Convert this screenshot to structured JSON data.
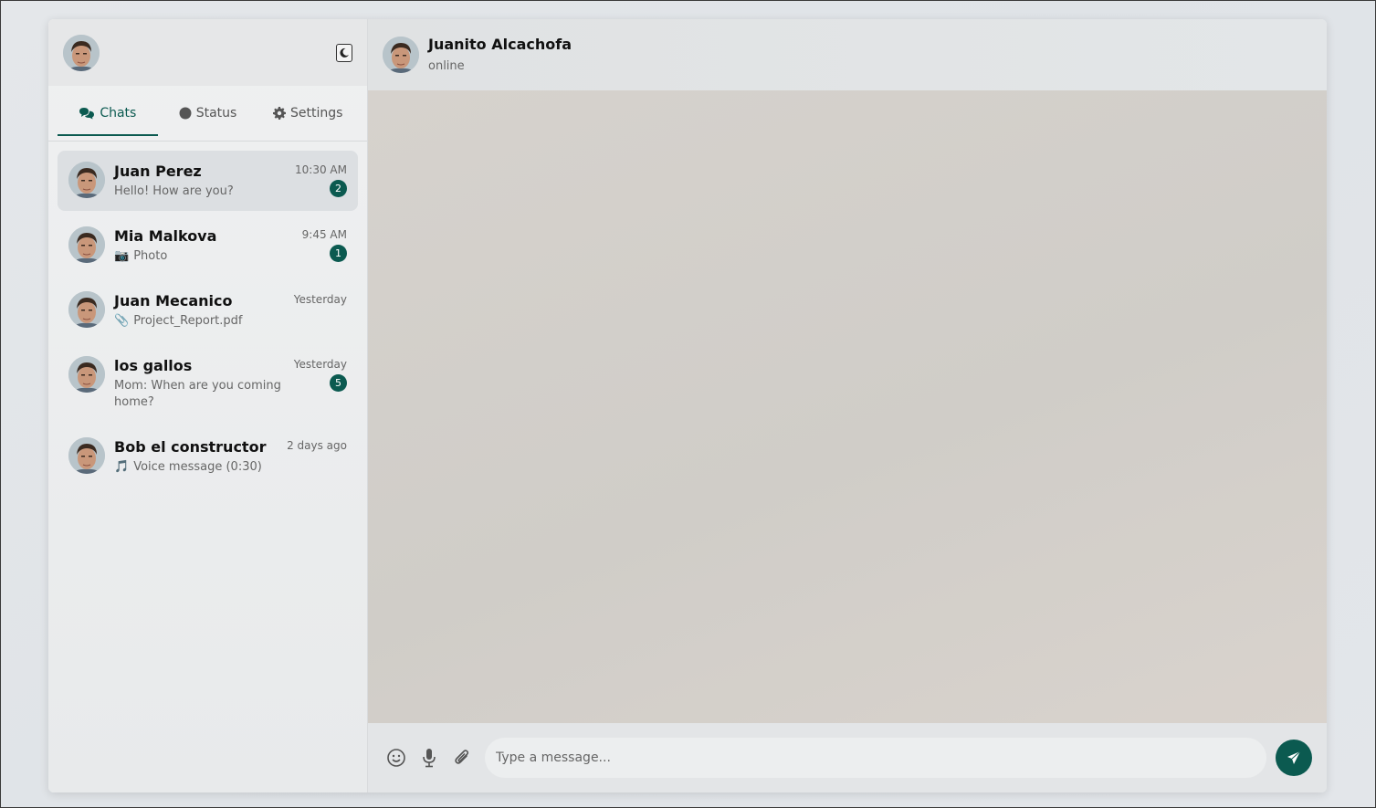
{
  "sidebar": {
    "theme_toggle_icon": "moon-icon",
    "tabs": [
      {
        "label": "Chats",
        "icon": "chats-icon",
        "active": true
      },
      {
        "label": "Status",
        "icon": "status-circle-icon",
        "active": false
      },
      {
        "label": "Settings",
        "icon": "gear-icon",
        "active": false
      }
    ],
    "chats": [
      {
        "name": "Juan Perez",
        "time": "10:30 AM",
        "preview": "Hello! How are you?",
        "preview_icon": "",
        "unread": "2",
        "selected": true
      },
      {
        "name": "Mia Malkova",
        "time": "9:45 AM",
        "preview": "Photo",
        "preview_icon": "📷",
        "unread": "1",
        "selected": false
      },
      {
        "name": "Juan Mecanico",
        "time": "Yesterday",
        "preview": "Project_Report.pdf",
        "preview_icon": "📎",
        "unread": "",
        "selected": false
      },
      {
        "name": "los gallos",
        "time": "Yesterday",
        "preview": "Mom: When are you coming home?",
        "preview_icon": "",
        "unread": "5",
        "selected": false
      },
      {
        "name": "Bob el constructor",
        "time": "2 days ago",
        "preview": "Voice message (0:30)",
        "preview_icon": "🎵",
        "unread": "",
        "selected": false
      }
    ]
  },
  "conversation": {
    "name": "Juanito Alcachofa",
    "status": "online"
  },
  "composer": {
    "placeholder": "Type a message...",
    "icons": [
      "emoji-icon",
      "microphone-icon",
      "paperclip-icon",
      "send-icon"
    ]
  },
  "colors": {
    "accent": "#0b5a50"
  }
}
